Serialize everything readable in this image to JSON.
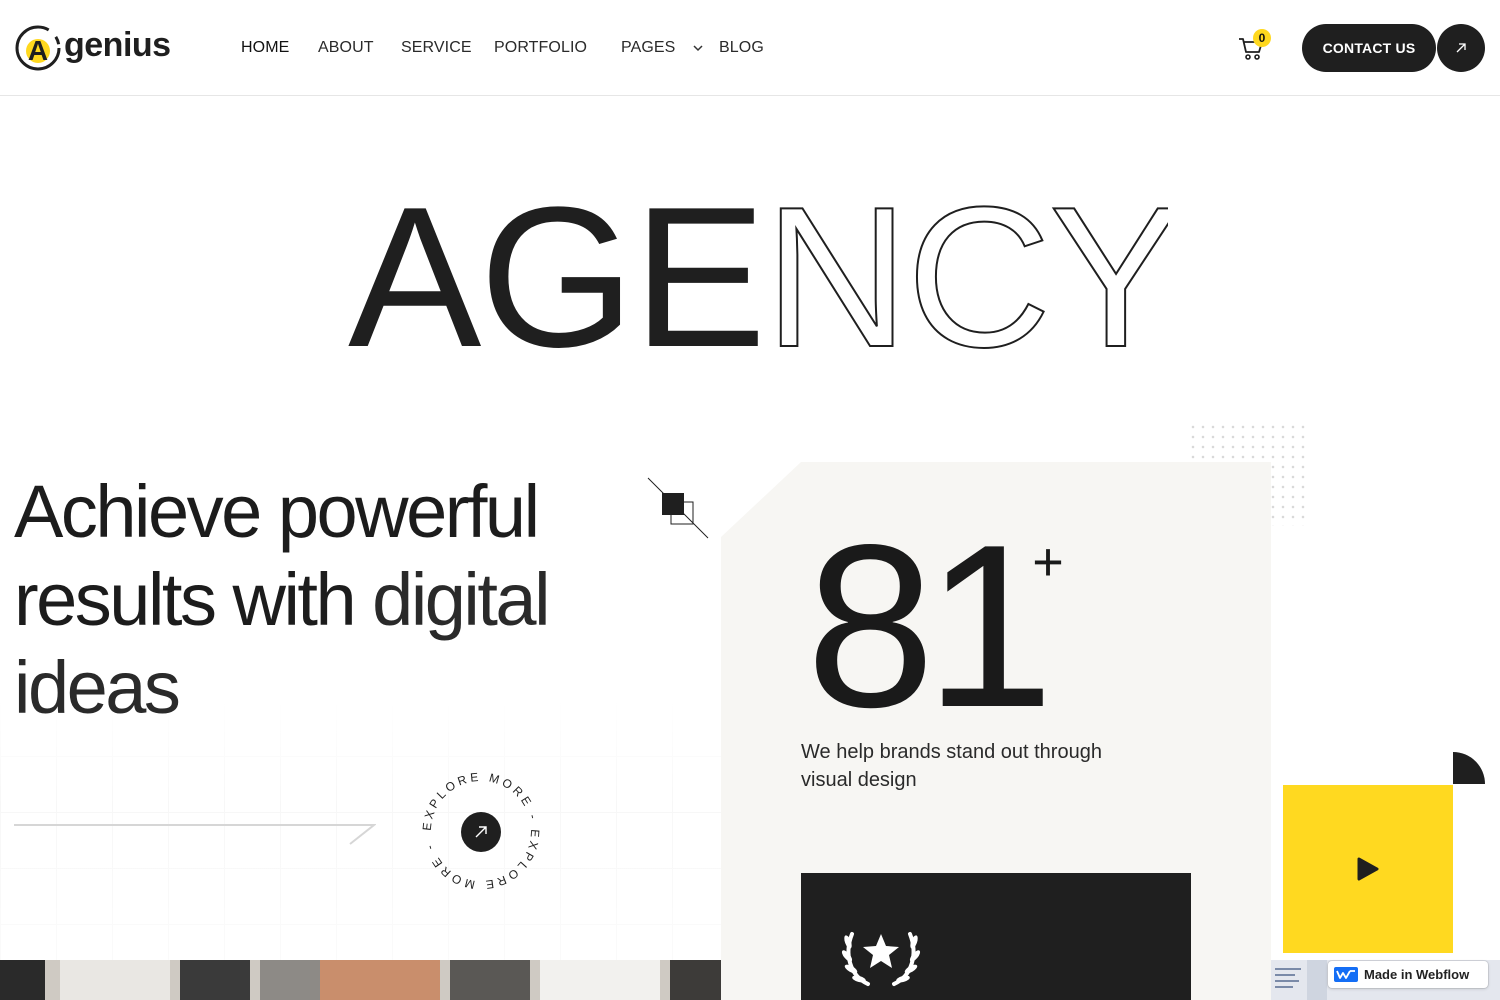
{
  "brand": {
    "name": "genius",
    "logo_letter": "A",
    "accent": "#ffd81e",
    "dark": "#1f1f1f"
  },
  "nav": {
    "items": [
      {
        "label": "HOME",
        "active": true
      },
      {
        "label": "ABOUT"
      },
      {
        "label": "SERVICE"
      },
      {
        "label": "PORTFOLIO"
      },
      {
        "label": "PAGES",
        "has_dropdown": true
      },
      {
        "label": "BLOG"
      }
    ]
  },
  "header": {
    "cart_count": "0",
    "contact_label": "CONTACT US"
  },
  "hero": {
    "title_solid": "AGE",
    "title_outline": "NCY",
    "heading_bold": "Achieve powerful results with",
    "heading_light": "digital ideas",
    "explore_text": "EXPLORE MORE - EXPLORE MORE - "
  },
  "stats": {
    "number": "81",
    "suffix": "+",
    "description": "We help brands stand out through visual design"
  },
  "footer_badge": {
    "label": "Made in Webflow"
  }
}
